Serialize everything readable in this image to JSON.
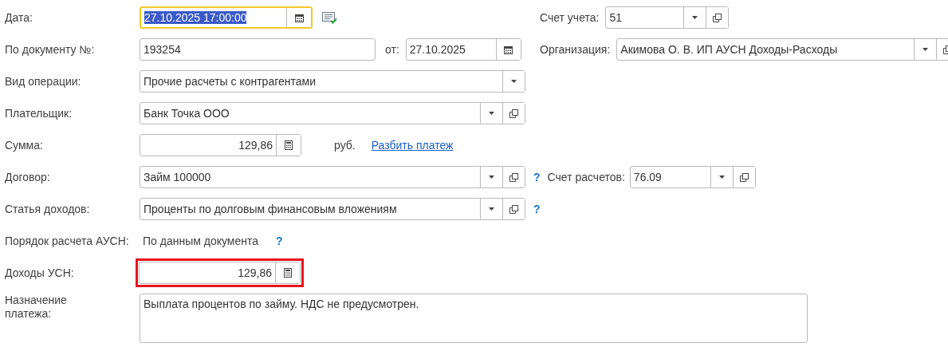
{
  "date": {
    "label": "Дата:",
    "value": "27.10.2025 17:00:00",
    "focused": true,
    "text_selected": true,
    "buttons": [
      {
        "kind": "calendar"
      }
    ]
  },
  "account": {
    "label": "Счет учета:",
    "value": "51",
    "buttons": [
      {
        "kind": "dropdown"
      },
      {
        "kind": "open"
      }
    ]
  },
  "doc_number": {
    "label": "По документу №:",
    "value": "193254"
  },
  "doc_date": {
    "label": "от:",
    "value": "27.10.2025",
    "buttons": [
      {
        "kind": "calendar"
      }
    ]
  },
  "organization": {
    "label": "Организация:",
    "value": "Акимова О. В. ИП АУСН Доходы-Расходы",
    "buttons": [
      {
        "kind": "dropdown"
      },
      {
        "kind": "open"
      }
    ]
  },
  "operation": {
    "label": "Вид операции:",
    "value": "Прочие расчеты с контрагентами",
    "buttons": [
      {
        "kind": "dropdown"
      }
    ]
  },
  "payer": {
    "label": "Плательщик:",
    "value": "Банк Точка ООО",
    "buttons": [
      {
        "kind": "dropdown"
      },
      {
        "kind": "open"
      }
    ]
  },
  "amount": {
    "label": "Сумма:",
    "value": "129,86",
    "buttons": [
      {
        "kind": "calculator"
      }
    ],
    "currency": "руб.",
    "link": "Разбить платеж"
  },
  "contract": {
    "label": "Договор:",
    "value": "Займ 100000",
    "buttons": [
      {
        "kind": "dropdown"
      },
      {
        "kind": "open"
      }
    ],
    "help": "?"
  },
  "settlement_account": {
    "label": "Счет расчетов:",
    "value": "76.09",
    "buttons": [
      {
        "kind": "dropdown"
      },
      {
        "kind": "open"
      }
    ]
  },
  "income_item": {
    "label": "Статья доходов:",
    "value": "Проценты по долговым финансовым вложениям",
    "buttons": [
      {
        "kind": "dropdown"
      },
      {
        "kind": "open"
      }
    ],
    "help": "?"
  },
  "ausn_order": {
    "label": "Порядок расчета АУСН:",
    "value": "По данным документа",
    "help": "?"
  },
  "usn_income": {
    "label": "Доходы УСН:",
    "value": "129,86",
    "buttons": [
      {
        "kind": "calculator"
      }
    ],
    "highlighted": true
  },
  "purpose": {
    "label": "Назначение платежа:",
    "value": "Выплата процентов по займу. НДС не предусмотрен."
  }
}
